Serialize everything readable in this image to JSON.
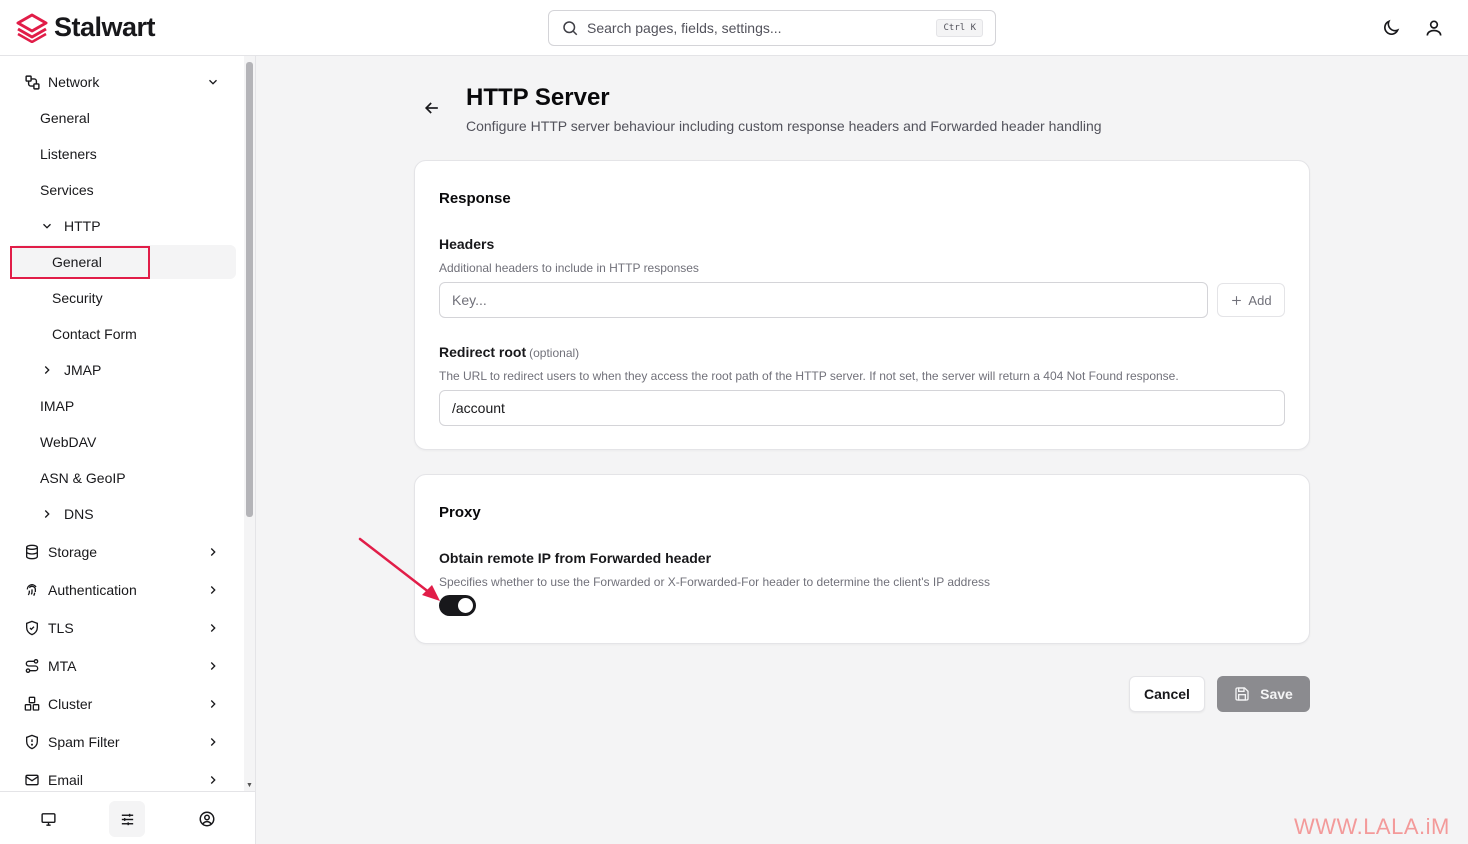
{
  "app": {
    "name": "Stalwart",
    "brand_color": "#e11d48"
  },
  "search": {
    "placeholder": "Search pages, fields, settings...",
    "shortcut": "Ctrl K"
  },
  "header_icons": [
    "moon-icon",
    "user-icon"
  ],
  "sidebar": {
    "network": {
      "label": "Network",
      "icon": "network-icon",
      "expanded": true
    },
    "network_items": {
      "general": "General",
      "listeners": "Listeners",
      "services": "Services",
      "http": "HTTP",
      "http_general": "General",
      "http_security": "Security",
      "http_contact": "Contact Form",
      "jmap": "JMAP",
      "imap": "IMAP",
      "webdav": "WebDAV",
      "asn": "ASN & GeoIP",
      "dns": "DNS"
    },
    "sections": {
      "storage": "Storage",
      "authentication": "Authentication",
      "tls": "TLS",
      "mta": "MTA",
      "cluster": "Cluster",
      "spam": "Spam Filter",
      "email": "Email"
    },
    "active_item": "General",
    "bottom_icons": [
      "monitor-icon",
      "sliders-icon",
      "account-circle-icon"
    ]
  },
  "page": {
    "title": "HTTP Server",
    "subtitle": "Configure HTTP server behaviour including custom response headers and Forwarded header handling"
  },
  "response_card": {
    "title": "Response",
    "headers_label": "Headers",
    "headers_help": "Additional headers to include in HTTP responses",
    "key_placeholder": "Key...",
    "add_label": "Add",
    "redirect_label": "Redirect root",
    "redirect_optional": "(optional)",
    "redirect_help": "The URL to redirect users to when they access the root path of the HTTP server. If not set, the server will return a 404 Not Found response.",
    "redirect_value": "/account"
  },
  "proxy_card": {
    "title": "Proxy",
    "forwarded_label": "Obtain remote IP from Forwarded header",
    "forwarded_help": "Specifies whether to use the Forwarded or X-Forwarded-For header to determine the client's IP address",
    "forwarded_enabled": true
  },
  "actions": {
    "cancel": "Cancel",
    "save": "Save"
  },
  "watermark": "WWW.LALA.iM",
  "annotation_color": "#e11d48"
}
